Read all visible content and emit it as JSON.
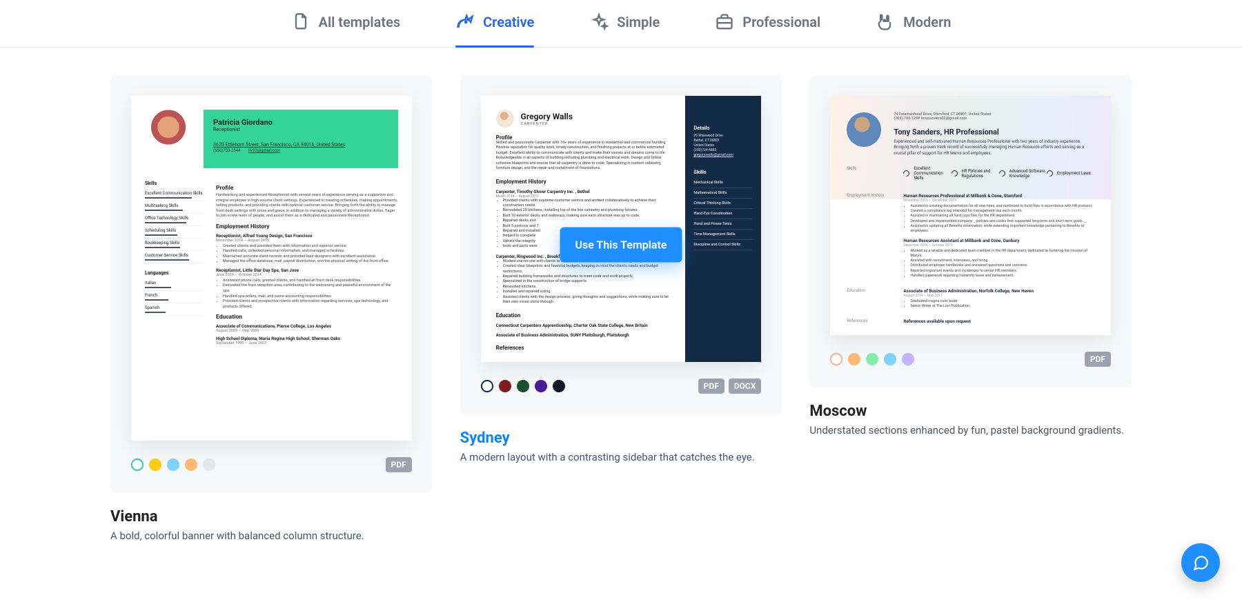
{
  "tabs": [
    {
      "label": "All templates",
      "icon": "files-icon",
      "active": false
    },
    {
      "label": "Creative",
      "icon": "unicorn-icon",
      "active": true
    },
    {
      "label": "Simple",
      "icon": "sparkle-icon",
      "active": false
    },
    {
      "label": "Professional",
      "icon": "briefcase-icon",
      "active": false
    },
    {
      "label": "Modern",
      "icon": "rock-on-icon",
      "active": false
    }
  ],
  "use_button_label": "Use This Template",
  "templates": [
    {
      "name": "Vienna",
      "desc": "A bold, colorful banner with balanced column structure.",
      "formats": [
        "PDF"
      ],
      "swatches": [
        "#34d399",
        "#facc15",
        "#7dd3fc",
        "#fdba74",
        "#e5e7eb"
      ],
      "selected_swatch": 0,
      "active": false,
      "content": {
        "person": "Patricia Giordano",
        "title": "Receptionist",
        "address": "3620 Ettlehorn Street, San Francisco, CA 94016, United States",
        "phone": "(530)733-2544",
        "email": "liv52@gmail.com",
        "skills_heading": "Skills",
        "skills": [
          "Excellent Communication Skills",
          "Multitasking Skills",
          "Office Technology Skills",
          "Scheduling Skills",
          "Bookkeeping Skills",
          "Customer Service Skills"
        ],
        "lang_heading": "Languages",
        "langs": [
          "Italian",
          "French",
          "Spanish"
        ],
        "profile_heading": "Profile",
        "profile": "Hardworking and experienced Receptionist with several years of experience serving as a supportive and integral employee in high-volume client settings. Experienced in creating schedules, making appointments, selling products, and providing clients with optimal customer service. Bringing forth the ability to manage front desk settings with poise and grace, in addition to managing a variety of administrative duties. Eager to join a new team of people, and assist them as a dedicated and passionate Receptionist.",
        "emp_heading": "Employment History",
        "jobs": [
          {
            "role": "Receptionist, Alfred Young Design, San Francisco",
            "dates": "November 2014 — August 2019",
            "bullets": [
              "Greeted clients and provided them with information and superior service.",
              "Handled calls, collected personal information, and managed schedules.",
              "Maintained accurate client records and provided lead designers with excellent assistance.",
              "Managed the office database, mail, payroll distribution, and the physical setting of the front office."
            ]
          },
          {
            "role": "Receptionist, Little Star Day Spa, San Jose",
            "dates": "June 2003 — October 2014",
            "bullets": [
              "Answered phone calls, greeted clients, and handled all front desk responsibilities.",
              "Decorated the front reception area, contributing to the welcoming and peaceful environment of the spa.",
              "Handled spa orders, mail, and some accounting responsibilities.",
              "Provided clients and prospective clients with information regarding services, spa technology, and products offered."
            ]
          }
        ],
        "edu_heading": "Education",
        "edu": [
          {
            "line": "Associate of Communications, Pierce College, Los Angeles",
            "dates": "August 2003 — May 2005"
          },
          {
            "line": "High School Diploma, Maria Regina High School, Sherman Oaks",
            "dates": "September 1999 — June 2003"
          }
        ]
      }
    },
    {
      "name": "Sydney",
      "desc": "A modern layout with a contrasting sidebar that catches the eye.",
      "formats": [
        "PDF",
        "DOCX"
      ],
      "swatches": [
        "#132a47",
        "#7f1d1d",
        "#14532d",
        "#4c1d95",
        "#111827"
      ],
      "selected_swatch": 0,
      "active": true,
      "content": {
        "person": "Gregory Walls",
        "title": "CARPENTER",
        "profile_heading": "Profile",
        "profile": "Skilled and passionate Carpenter with 10+ years of experience in residential and commercial building. Positive reputation for quality work, timely construction, and finishing projects at or below estimated budget. Excellent ability to communicate with clients and make their visions and dreams come to life. Knowledgeable in all aspects of building including plumbing and electrical work. Design and follow cohesive blueprints and ensure that all carpentry is done to code. Specializing in custom cabinetry, furniture design, and the repair and installment of foundations.",
        "emp_heading": "Employment History",
        "jobs": [
          {
            "role": "Carpenter, Timothy Glover Carpentry Inc. , Bethel",
            "dates": "March 2014 — August 2019",
            "bullets": [
              "Provided clients with supreme customer service and worked collaboratively to achieve their construction needs.",
              "Remodeled 20 kitchens, installing top of the line cabinetry and plumbing fixtures.",
              "Built 10 exterior decks and walkways, making sure each structure was up to code.",
              "Repaired decks and",
              "Built 5 porticos and 7",
              "Repaired and installed",
              "Helped to complete",
              "Upheld the integrity",
              "tools and parts were"
            ]
          },
          {
            "role": "Carpenter, Ringwood Inc. , Brookfield",
            "dates": "",
            "bullets": [
              "Worked one-on-one with clients to assess their needs and desires before beginning construction.",
              "Created clear blueprints and financial budgets, keeping in mind the client's needs and budget restrictions.",
              "Repaired building frameworks and structures to meet code and work properly.",
              "Specialized in the construction of bridge supports.",
              "Renovated kitchens.",
              "Installed and repaired siding.",
              "Assisted clients with the design process, giving thoughts and suggestions, while making sure to let their own vision shine through."
            ]
          }
        ],
        "edu_heading": "Education",
        "edu": [
          "Connecticut Carpenters Apprenticeship, Charter Oak State College, New Britain",
          "Associate of Business Administration, SUNY Plattsburgh, Plattsburgh"
        ],
        "ref_heading": "References",
        "details": {
          "heading": "Details",
          "lines": [
            "26 Wisewood Drive",
            "Bethel, CT 06801",
            "United States",
            "(203)724-4883",
            "gregory.walls@gmail.com"
          ]
        },
        "skills_heading": "Skills",
        "skills": [
          "Mechanical Skills",
          "Mathematical Skills",
          "Critical Thinking Skills",
          "Hand-Eye Coordination",
          "Hand and Power Tools",
          "Time Management Skills",
          "Discipline and Control Skills"
        ]
      }
    },
    {
      "name": "Moscow",
      "desc": "Understated sections enhanced by fun, pastel background gradients.",
      "formats": [
        "PDF"
      ],
      "swatches": [
        "#f8b4a0",
        "#fdba74",
        "#86efac",
        "#7dd3fc",
        "#c4b5fd"
      ],
      "selected_swatch": 0,
      "active": false,
      "content": {
        "address": "74 Fountainhead Drive, Stamford, CT 06901, United States",
        "contact": "(203)-708-1259    tonysanders02@gmail.com",
        "person": "Tony Sanders, HR Professional",
        "summary": "Experienced and self-motivated Human Resources Professional with two years of industry experience. Bringing forth a proven track record of successfully managing Human Resource efforts and serving as a crucial pillar of support for HR teams and employees.",
        "skills_heading": "Skills",
        "skills": [
          "Excellent Communication Skills",
          "HR Policies and Regulations",
          "Advanced Software Knowledge",
          "Employment Laws"
        ],
        "emp_heading": "Employment History",
        "jobs": [
          {
            "role": "Human Resources Professional at Milbank & Cone, Stamford",
            "dates": "November 2016 — December 2019",
            "bullets": [
              "Assisted in creating documentation for all new hires, and continued to build files in accordance with HR protocol.",
              "Created a compliance log intended for management use each month.",
              "Assisted in maintaining all hard copy files for the HR department.",
              "Developed and implemented company _ policies and codes that supported long-term and short-term  goals. _",
              "Assisted in updating all Benefits information, while extending important knowledge pertaining to Benefits to employees."
            ]
          },
          {
            "role": "Human Resources Assistant at Millbank and Cone, Danbury",
            "dates": "December 2014 — October 2016",
            "bullets": [
              "Worked as a reliable and dedicated team member in the HR department, dedicated to fostering the mission of Macy's.",
              "Assisted with recruitment, interviews, and hiring.",
              "Distributed employee handbooks and answered questions and concerns.",
              "Reported important events and incidences to senior HR members.",
              "Handled paperwork regarding maternity leave and bereavement."
            ]
          }
        ],
        "edu_heading": "Education",
        "edu": {
          "line": "Associate of Business Administration, Norfolk College, New Haven",
          "dates": "August 2014 — May 2017",
          "bullets": [
            "Graduated magna cum laude.",
            "Senior Writer at The Lion Publication."
          ]
        },
        "ref_heading": "References",
        "ref_text": "References available upon request"
      }
    }
  ]
}
